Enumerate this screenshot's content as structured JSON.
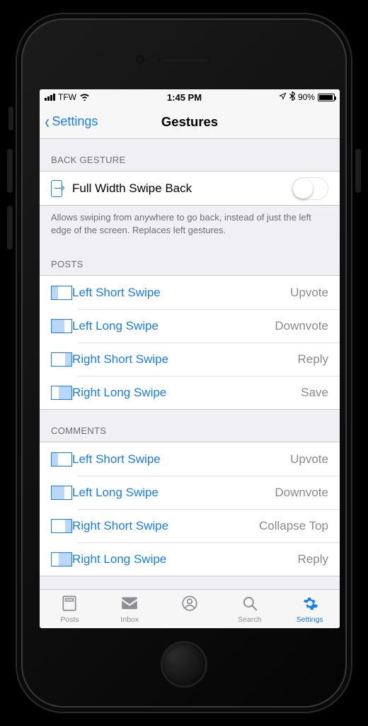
{
  "status": {
    "carrier": "TFW",
    "time": "1:45 PM",
    "battery_pct": "90%"
  },
  "nav": {
    "back_label": "Settings",
    "title": "Gestures"
  },
  "sections": {
    "back_gesture": {
      "header": "BACK GESTURE",
      "row_label": "Full Width Swipe Back",
      "toggle_on": false,
      "footer": "Allows swiping from anywhere to go back, instead of just the left edge of the screen. Replaces left gestures."
    },
    "posts": {
      "header": "POSTS",
      "rows": [
        {
          "label": "Left Short Swipe",
          "detail": "Upvote"
        },
        {
          "label": "Left Long Swipe",
          "detail": "Downvote"
        },
        {
          "label": "Right Short Swipe",
          "detail": "Reply"
        },
        {
          "label": "Right Long Swipe",
          "detail": "Save"
        }
      ]
    },
    "comments": {
      "header": "COMMENTS",
      "rows": [
        {
          "label": "Left Short Swipe",
          "detail": "Upvote"
        },
        {
          "label": "Left Long Swipe",
          "detail": "Downvote"
        },
        {
          "label": "Right Short Swipe",
          "detail": "Collapse Top"
        },
        {
          "label": "Right Long Swipe",
          "detail": "Reply"
        }
      ]
    }
  },
  "tabs": {
    "posts": "Posts",
    "inbox": "Inbox",
    "search": "Search",
    "settings": "Settings"
  }
}
